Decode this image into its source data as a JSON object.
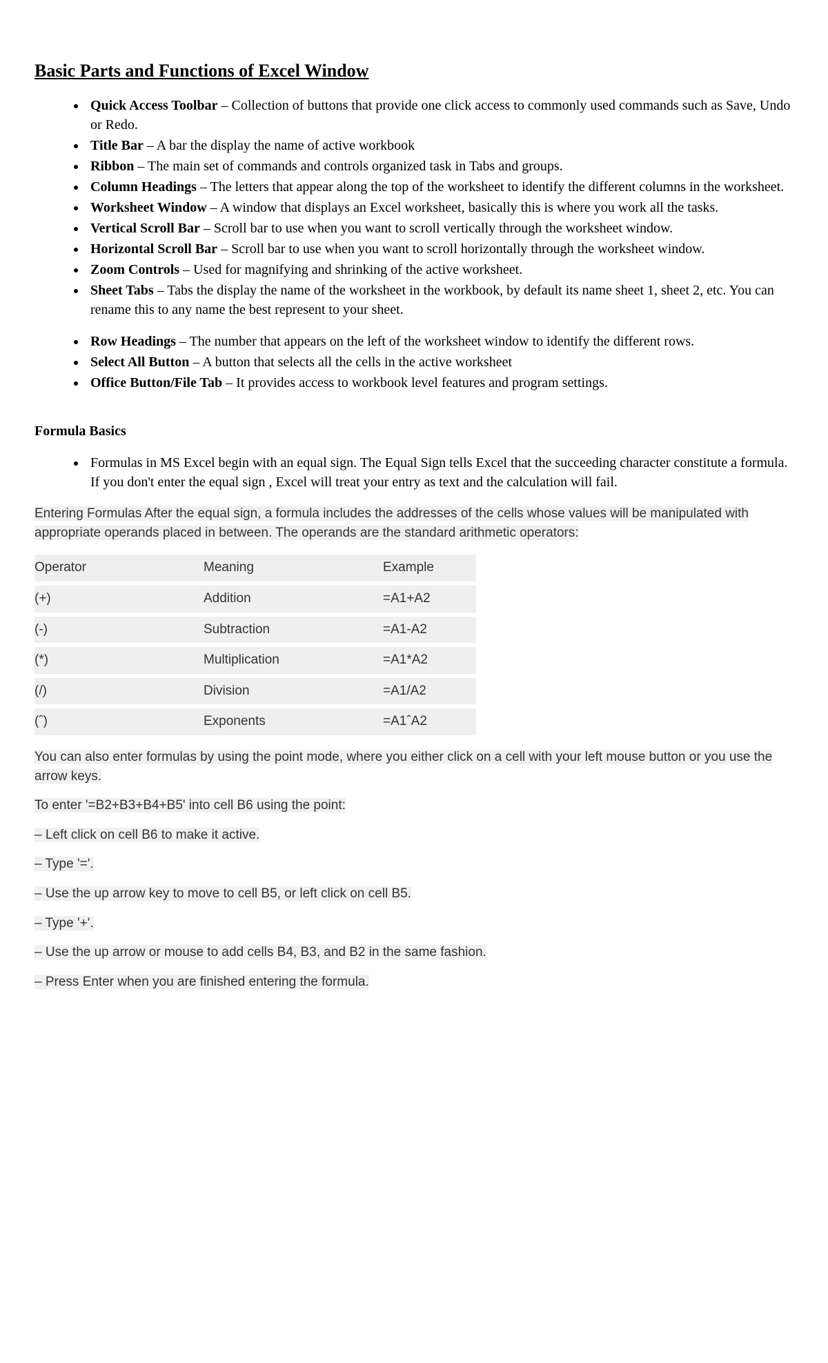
{
  "title": "Basic Parts and Functions of Excel Window",
  "partsA": [
    {
      "term": "Quick Access Toolbar",
      "desc": " – Collection of buttons that provide one click access to commonly used commands such as Save, Undo or Redo."
    },
    {
      "term": "Title Bar",
      "desc": " – A bar the display the name of active workbook"
    },
    {
      "term": "Ribbon",
      "desc": " – The main set of commands and controls organized task in Tabs and groups."
    },
    {
      "term": "Column Headings",
      "desc": " – The letters that appear along the top of the worksheet to identify the different columns in the worksheet."
    },
    {
      "term": "Worksheet Window",
      "desc": " – A window that displays an Excel worksheet, basically this is where you work all the tasks."
    },
    {
      "term": "Vertical Scroll Bar",
      "desc": " – Scroll bar to use when you want to scroll vertically through the worksheet window."
    },
    {
      "term": "Horizontal Scroll Bar",
      "desc": " – Scroll bar to use when you want to scroll horizontally through the worksheet window."
    },
    {
      "term": "Zoom Controls",
      "desc": " – Used for magnifying and shrinking of the active worksheet."
    },
    {
      "term": "Sheet Tabs",
      "desc": " – Tabs the display the name of the worksheet in the workbook, by default its name sheet 1, sheet 2, etc. You can rename this to any name the best represent to your sheet."
    }
  ],
  "partsB": [
    {
      "term": "Row Headings",
      "desc": " – The number that appears on the left of the worksheet window to identify the different rows."
    },
    {
      "term": "Select All Button",
      "desc": " – A button that selects all the cells in the active worksheet"
    },
    {
      "term": "Office Button/File Tab",
      "desc": " – It provides access to workbook level features and program settings."
    }
  ],
  "formula": {
    "heading": "Formula Basics",
    "intro": "Formulas in MS Excel begin with an equal sign. The Equal Sign tells Excel that the succeeding character constitute a formula. If you don't enter the equal sign , Excel will treat your entry as text and the calculation will fail.",
    "entering": "Entering Formulas After the equal sign, a formula includes the addresses of the cells whose values will be manipulated with appropriate operands placed in between. The operands are the standard arithmetic operators:"
  },
  "table": {
    "headers": [
      "Operator",
      "Meaning",
      "Example"
    ],
    "rows": [
      [
        "(+)",
        "Addition",
        "=A1+A2"
      ],
      [
        "(-)",
        "Subtraction",
        "=A1-A2"
      ],
      [
        "(*)",
        "Multiplication",
        "=A1*A2"
      ],
      [
        "(/)",
        "Division",
        "=A1/A2"
      ],
      [
        "(ˆ)",
        "Exponents",
        "=A1ˆA2"
      ]
    ]
  },
  "pointmode": "You can also enter formulas by using the point mode, where you either click on a cell with your left mouse button or you use the arrow keys.",
  "entersteps_intro": "To enter '=B2+B3+B4+B5' into cell B6 using the point:",
  "steps": [
    "– Left click on cell B6 to make it active.",
    "– Type  '='.",
    "– Use the up arrow key to move to cell B5, or left click on cell B5.",
    "– Type '+'.",
    "– Use the up arrow or mouse to add cells B4, B3, and B2 in the same fashion.",
    "– Press Enter when you are finished entering the formula."
  ]
}
